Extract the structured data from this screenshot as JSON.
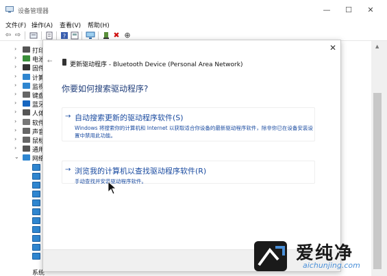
{
  "window": {
    "title": "设备管理器",
    "minimize_glyph": "—",
    "maximize_glyph": "☐",
    "close_glyph": "✕"
  },
  "menu": {
    "items": [
      {
        "label": "文件(F)"
      },
      {
        "label": "操作(A)"
      },
      {
        "label": "查看(V)"
      },
      {
        "label": "帮助(H)"
      }
    ]
  },
  "toolbar": {
    "icons": [
      "back-arrow-icon",
      "forward-arrow-icon",
      "properties-icon",
      "list-icon",
      "help-icon",
      "view-icon",
      "monitor-icon",
      "update-driver-icon",
      "uninstall-icon",
      "download-icon"
    ],
    "back_glyph": "⇦",
    "forward_glyph": "⇨",
    "uninstall_glyph": "✖",
    "download_glyph": "⊕"
  },
  "tree": {
    "items": [
      {
        "label": "打印",
        "icon": "printer-icon",
        "color": "#555555"
      },
      {
        "label": "电池",
        "icon": "battery-icon",
        "color": "#3a8f3a"
      },
      {
        "label": "固件",
        "icon": "firmware-icon",
        "color": "#333333"
      },
      {
        "label": "计算",
        "icon": "computer-icon",
        "color": "#2f86d0"
      },
      {
        "label": "监视",
        "icon": "monitor-icon",
        "color": "#2f86d0"
      },
      {
        "label": "键盘",
        "icon": "keyboard-icon",
        "color": "#666666"
      },
      {
        "label": "蓝牙",
        "icon": "bluetooth-icon",
        "color": "#1565c0"
      },
      {
        "label": "人体",
        "icon": "human-interface-icon",
        "color": "#555555"
      },
      {
        "label": "软件",
        "icon": "software-icon",
        "color": "#777777"
      },
      {
        "label": "声音",
        "icon": "speaker-icon",
        "color": "#666666"
      },
      {
        "label": "鼠标",
        "icon": "mouse-icon",
        "color": "#666666"
      },
      {
        "label": "通用",
        "icon": "usb-icon",
        "color": "#555555"
      },
      {
        "label": "网络",
        "icon": "network-icon",
        "color": "#2f86d0"
      }
    ],
    "network_children_count_label": "",
    "bottom_label": "系统"
  },
  "dialog": {
    "close_glyph": "✕",
    "back_glyph": "←",
    "title": "更新驱动程序 - Bluetooth Device (Personal Area Network)",
    "heading": "你要如何搜索驱动程序?",
    "options": [
      {
        "arrow": "→",
        "title": "自动搜索更新的驱动程序软件(S)",
        "description": "Windows 将搜索你的计算机和 Internet 以获取适合你设备的最新驱动程序软件，除非你已在设备安装设置中禁用此功能。"
      },
      {
        "arrow": "→",
        "title": "浏览我的计算机以查找驱动程序软件(R)",
        "description": "手动查找并安装驱动程序软件。"
      }
    ]
  },
  "watermark": {
    "text": "爱纯净",
    "url": "aichunjing.com"
  },
  "colors": {
    "link_blue": "#1a4ba0",
    "heading_blue": "#1f3d7a",
    "network_icon_blue": "#2f86d0"
  }
}
